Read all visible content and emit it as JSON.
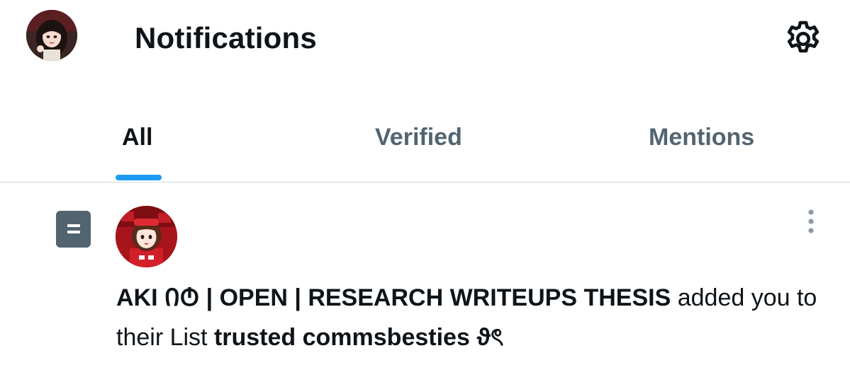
{
  "header": {
    "title": "Notifications",
    "avatar_icon": "user-avatar",
    "settings_icon": "gear-icon"
  },
  "tabs": [
    {
      "label": "All",
      "active": true
    },
    {
      "label": "Verified",
      "active": false
    },
    {
      "label": "Mentions",
      "active": false
    }
  ],
  "notification": {
    "type_icon": "list-icon",
    "actor_avatar_icon": "user-avatar",
    "actor_name": "AKI ᲘᲢ | OPEN | RESEARCH WRITEUPS THESIS",
    "action_text": " added you to their List ",
    "list_name": "trusted commsbesties ϑৎ",
    "more_icon": "more-vertical-icon"
  },
  "colors": {
    "accent": "#1d9bf0",
    "text_primary": "#0f1419",
    "text_secondary": "#536471",
    "divider": "#d4d9dd"
  }
}
